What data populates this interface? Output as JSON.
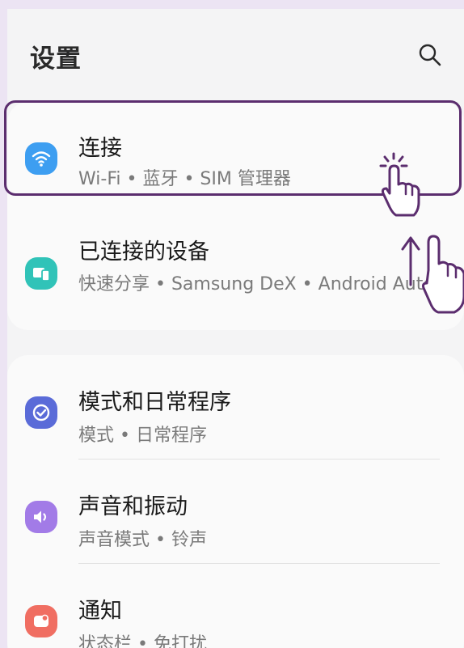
{
  "header": {
    "title": "设置",
    "search_icon": "search-icon"
  },
  "section1": {
    "items": [
      {
        "title": "连接",
        "subtitle": "Wi-Fi • 蓝牙 • SIM 管理器",
        "icon": "wifi-icon",
        "color": "#3d9ef1"
      },
      {
        "title": "已连接的设备",
        "subtitle": "快速分享 • Samsung DeX • Android Auto",
        "icon": "connected-devices-icon",
        "color": "#30c3b8"
      }
    ]
  },
  "section2": {
    "items": [
      {
        "title": "模式和日常程序",
        "subtitle": "模式 • 日常程序",
        "icon": "check-circle-icon",
        "color": "#5a6bd8"
      },
      {
        "title": "声音和振动",
        "subtitle": "声音模式 • 铃声",
        "icon": "volume-icon",
        "color": "#a27be7"
      },
      {
        "title": "通知",
        "subtitle": "状态栏 • 免打扰",
        "icon": "notification-icon",
        "color": "#f06e62"
      }
    ]
  },
  "overlay": {
    "highlight_color": "#5b2d6e",
    "gestures": [
      "tap-gesture-icon",
      "swipe-up-gesture-icon"
    ]
  }
}
